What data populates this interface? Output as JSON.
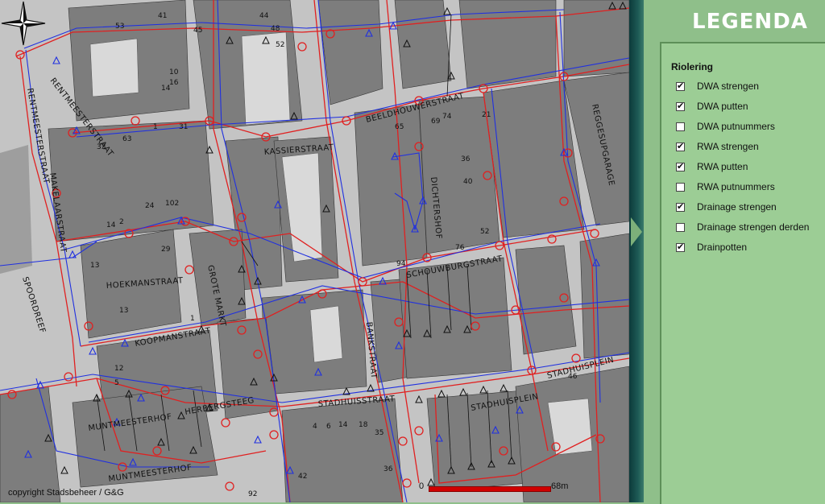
{
  "map": {
    "copyright": "copyright Stadsbeheer / G&G",
    "scale_start": "0",
    "scale_end": "68m",
    "streets": [
      "RENTMEESTERSTRAAT",
      "RENTMEESTERSTRAAT",
      "KASSIERSTRAAT",
      "BEELDHOUWERSTRAAT",
      "MAKELAARSTRAAT",
      "GROTE MARKT",
      "HOEKMANSTRAAT",
      "SPOORDREEF",
      "KOOPMANSTRAAT",
      "BANKSTRAAT",
      "DICHTERSHOF",
      "SCHOUWBURGSTRAAT",
      "STADHUISPLEIN",
      "STADHUISPLEIN",
      "STADHUISSTRAAT",
      "HERBERGSTEEG",
      "MUNTMEESTERHOF",
      "MUNTMEESTERHOF",
      "REGGESUPGARAGE"
    ],
    "numbers": [
      "53",
      "41",
      "45",
      "44",
      "48",
      "52",
      "14",
      "10",
      "16",
      "63",
      "33",
      "1",
      "31",
      "24",
      "102",
      "14",
      "2",
      "13",
      "13",
      "29",
      "65",
      "69",
      "74",
      "76",
      "36",
      "40",
      "52",
      "21",
      "12",
      "5",
      "1",
      "92",
      "94",
      "36",
      "35",
      "18",
      "14",
      "4",
      "6",
      "42",
      "46"
    ],
    "compass": "north-arrow"
  },
  "legend": {
    "title": "LEGENDA",
    "heading": "Riolering",
    "items": [
      {
        "label": "DWA strengen",
        "checked": true
      },
      {
        "label": "DWA putten",
        "checked": true
      },
      {
        "label": "DWA putnummers",
        "checked": false
      },
      {
        "label": "RWA strengen",
        "checked": true
      },
      {
        "label": "RWA putten",
        "checked": true
      },
      {
        "label": "RWA putnummers",
        "checked": false
      },
      {
        "label": "Drainage strengen",
        "checked": true
      },
      {
        "label": "Drainage strengen derden",
        "checked": false
      },
      {
        "label": "Drainpotten",
        "checked": true
      }
    ]
  },
  "colors": {
    "dwa": "#e02020",
    "rwa": "#2030e0",
    "building": "#7a7a7a",
    "road": "#c8c8c8",
    "panel": "#9ccd95"
  }
}
